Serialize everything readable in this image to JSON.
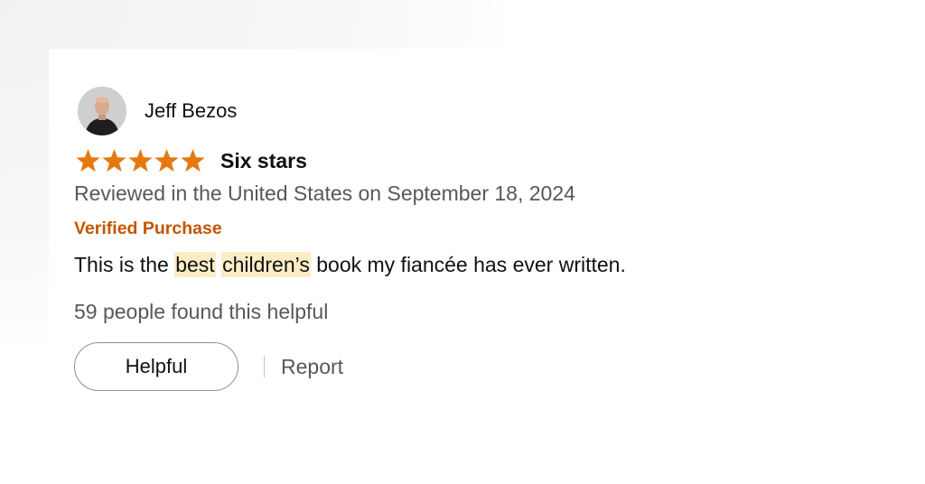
{
  "review": {
    "author": {
      "name": "Jeff Bezos",
      "avatar_icon": "profile-photo"
    },
    "rating": {
      "stars": 5,
      "max_stars": 5,
      "star_color": "#e47911"
    },
    "title": "Six stars",
    "date_line": "Reviewed in the United States on September 18, 2024",
    "verified_label": "Verified Purchase",
    "verified_color": "#c45500",
    "body": {
      "part1": "This is the ",
      "highlight1": "best",
      "space": " ",
      "highlight2": "children’s",
      "part2": " book my fiancée has ever written."
    },
    "highlight_color": "#fcecc4",
    "helpful_count_text": "59 people found this helpful",
    "actions": {
      "helpful_label": "Helpful",
      "report_label": "Report"
    }
  }
}
